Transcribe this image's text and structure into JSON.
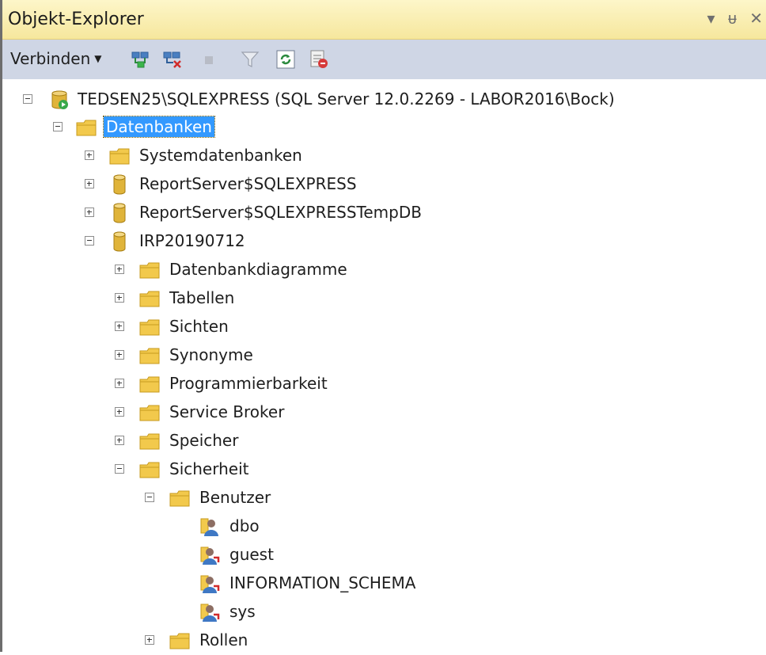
{
  "window": {
    "title": "Objekt-Explorer",
    "controls": [
      "▾",
      "ᵾ",
      "✕"
    ]
  },
  "toolbar": {
    "connect_label": "Verbinden"
  },
  "tree": {
    "server": "TEDSEN25\\SQLEXPRESS (SQL Server 12.0.2269 - LABOR2016\\Bock)",
    "databases": "Datenbanken",
    "system_databases": "Systemdatenbanken",
    "db1": "ReportServer$SQLEXPRESS",
    "db2": "ReportServer$SQLEXPRESSTempDB",
    "db3": "IRP20190712",
    "db3_children": [
      "Datenbankdiagramme",
      "Tabellen",
      "Sichten",
      "Synonyme",
      "Programmierbarkeit",
      "Service Broker",
      "Speicher"
    ],
    "security": "Sicherheit",
    "users": "Benutzer",
    "user_items": [
      "dbo",
      "guest",
      "INFORMATION_SCHEMA",
      "sys"
    ],
    "roles": "Rollen"
  },
  "colors": {
    "selection": "#3399ff",
    "title_bar": "#f6e79d",
    "toolbar": "#cfd6e5",
    "folder": "#f2c94c"
  }
}
